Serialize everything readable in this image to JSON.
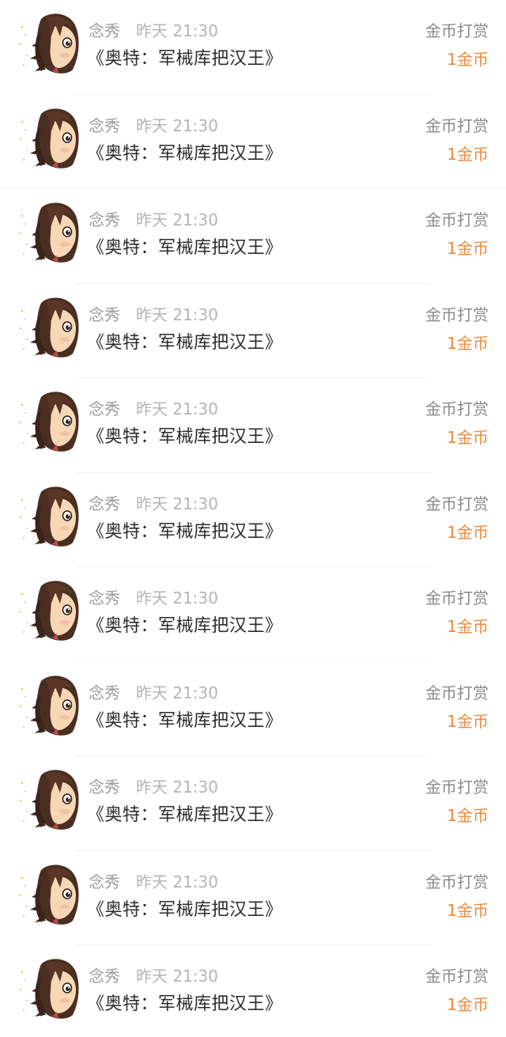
{
  "rewards": [
    {
      "user": "念秀",
      "time": "昨天 21:30",
      "book": "《奥特：军械库把汉王》",
      "type": "金币打赏",
      "amount": "1金币"
    },
    {
      "user": "念秀",
      "time": "昨天 21:30",
      "book": "《奥特：军械库把汉王》",
      "type": "金币打赏",
      "amount": "1金币"
    },
    {
      "user": "念秀",
      "time": "昨天 21:30",
      "book": "《奥特：军械库把汉王》",
      "type": "金币打赏",
      "amount": "1金币"
    },
    {
      "user": "念秀",
      "time": "昨天 21:30",
      "book": "《奥特：军械库把汉王》",
      "type": "金币打赏",
      "amount": "1金币"
    },
    {
      "user": "念秀",
      "time": "昨天 21:30",
      "book": "《奥特：军械库把汉王》",
      "type": "金币打赏",
      "amount": "1金币"
    },
    {
      "user": "念秀",
      "time": "昨天 21:30",
      "book": "《奥特：军械库把汉王》",
      "type": "金币打赏",
      "amount": "1金币"
    },
    {
      "user": "念秀",
      "time": "昨天 21:30",
      "book": "《奥特：军械库把汉王》",
      "type": "金币打赏",
      "amount": "1金币"
    },
    {
      "user": "念秀",
      "time": "昨天 21:30",
      "book": "《奥特：军械库把汉王》",
      "type": "金币打赏",
      "amount": "1金币"
    },
    {
      "user": "念秀",
      "time": "昨天 21:30",
      "book": "《奥特：军械库把汉王》",
      "type": "金币打赏",
      "amount": "1金币"
    },
    {
      "user": "念秀",
      "time": "昨天 21:30",
      "book": "《奥特：军械库把汉王》",
      "type": "金币打赏",
      "amount": "1金币"
    },
    {
      "user": "念秀",
      "time": "昨天 21:30",
      "book": "《奥特：军械库把汉王》",
      "type": "金币打赏",
      "amount": "1金币"
    }
  ],
  "colors": {
    "amount": "#ef8a3c",
    "meta": "#9b9b9b",
    "title": "#2b2b2b"
  },
  "icons": {
    "avatar": "anime-girl-avatar-icon"
  }
}
